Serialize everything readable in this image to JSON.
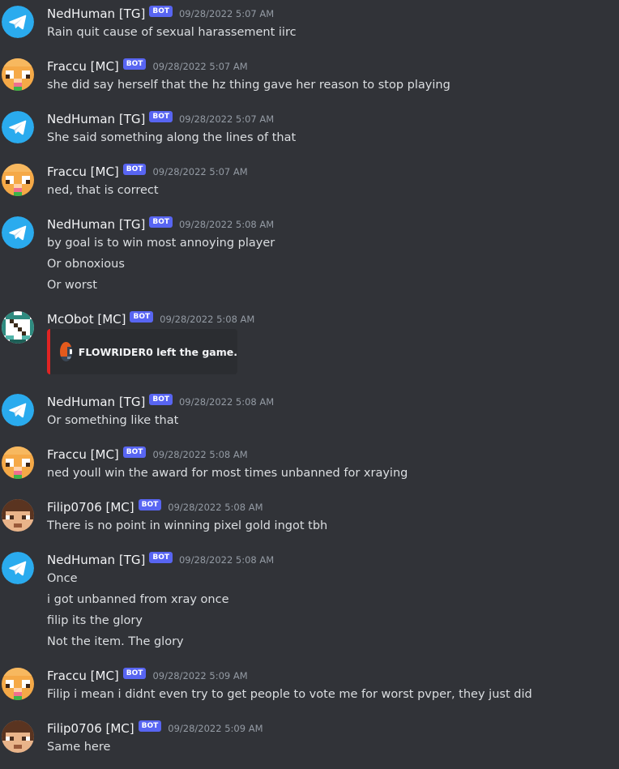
{
  "bot_tag": "BOT",
  "colors": {
    "background": "#313338",
    "bot_tag": "#5865f2",
    "embed_border": "#e02424",
    "telegram_blue": "#2aabee"
  },
  "messages": [
    {
      "author": "NedHuman [TG]",
      "avatar": "telegram-avatar",
      "timestamp": "09/28/2022 5:07 AM",
      "lines": [
        "Rain quit cause of sexual harassement iirc"
      ]
    },
    {
      "author": "Fraccu [MC]",
      "avatar": "fraccu-avatar",
      "timestamp": "09/28/2022 5:07 AM",
      "lines": [
        "she did say herself that the hz thing gave her reason to stop playing"
      ]
    },
    {
      "author": "NedHuman [TG]",
      "avatar": "telegram-avatar",
      "timestamp": "09/28/2022 5:07 AM",
      "lines": [
        "She said something along the lines of that"
      ]
    },
    {
      "author": "Fraccu [MC]",
      "avatar": "fraccu-avatar",
      "timestamp": "09/28/2022 5:07 AM",
      "lines": [
        "ned, that is correct"
      ]
    },
    {
      "author": "NedHuman [TG]",
      "avatar": "telegram-avatar",
      "timestamp": "09/28/2022 5:08 AM",
      "lines": [
        "by goal is to win most annoying player",
        "Or obnoxious",
        "Or worst"
      ]
    },
    {
      "author": "McObot [MC]",
      "avatar": "mcobot-avatar",
      "timestamp": "09/28/2022 5:08 AM",
      "embed": {
        "icon": "player-head-icon",
        "text": "FLOWRIDER0 left the game."
      }
    },
    {
      "author": "NedHuman [TG]",
      "avatar": "telegram-avatar",
      "timestamp": "09/28/2022 5:08 AM",
      "lines": [
        "Or something like that"
      ]
    },
    {
      "author": "Fraccu [MC]",
      "avatar": "fraccu-avatar",
      "timestamp": "09/28/2022 5:08 AM",
      "lines": [
        "ned youll win the award for most times unbanned for xraying"
      ]
    },
    {
      "author": "Filip0706 [MC]",
      "avatar": "filip-avatar",
      "timestamp": "09/28/2022 5:08 AM",
      "lines": [
        "There is no point in winning pixel gold ingot tbh"
      ]
    },
    {
      "author": "NedHuman [TG]",
      "avatar": "telegram-avatar",
      "timestamp": "09/28/2022 5:08 AM",
      "lines": [
        "Once",
        "i got unbanned from xray once",
        "filip its the glory",
        "Not the item. The glory"
      ]
    },
    {
      "author": "Fraccu [MC]",
      "avatar": "fraccu-avatar",
      "timestamp": "09/28/2022 5:09 AM",
      "lines": [
        "Filip i mean i didnt even try to get people to vote me for worst pvper, they just did"
      ]
    },
    {
      "author": "Filip0706 [MC]",
      "avatar": "filip-avatar",
      "timestamp": "09/28/2022 5:09 AM",
      "lines": [
        "Same here"
      ]
    }
  ]
}
